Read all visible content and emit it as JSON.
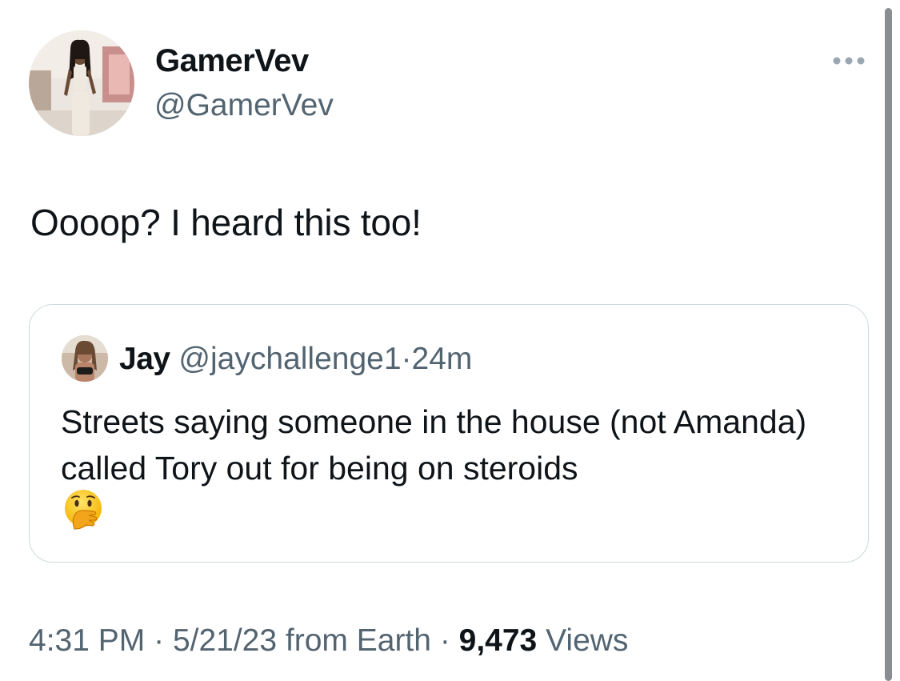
{
  "tweet": {
    "author": {
      "display_name": "GamerVev",
      "handle": "@GamerVev",
      "avatar_icon": "profile-photo"
    },
    "more_icon": "ellipsis-icon",
    "text": "Oooop? I heard this too!",
    "quoted": {
      "display_name": "Jay",
      "handle": "@jaychallenge1",
      "separator": "·",
      "time": "24m",
      "text": "Streets saying someone in the house (not Amanda) called Tory out for being on steroids",
      "emoji": "🫢"
    },
    "meta": {
      "time": "4:31 PM",
      "sep1": "·",
      "date": "5/21/23",
      "source": "from Earth",
      "sep2": "·",
      "views_count": "9,473",
      "views_label": "Views"
    }
  },
  "colors": {
    "primary_text": "#0f1419",
    "secondary_text": "#536471",
    "border": "#cfd9de"
  }
}
